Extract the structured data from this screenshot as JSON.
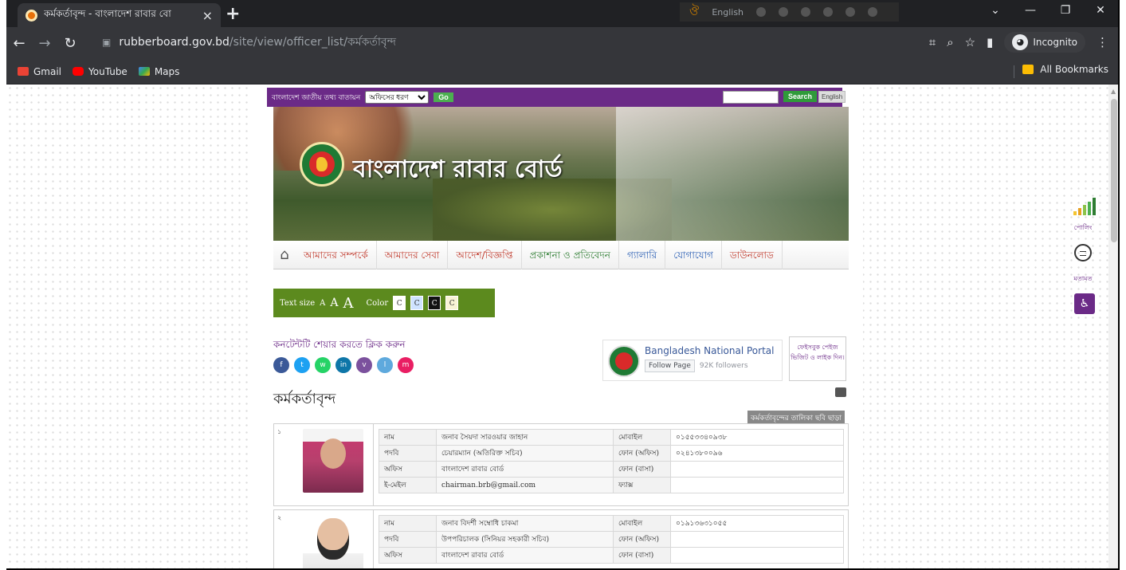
{
  "browser": {
    "tab_title": "কর্মকর্তাবৃন্দ - বাংলাদেশ রাবার বো",
    "new_tab_label": "+",
    "ime_language": "English",
    "url_host": "rubberboard.gov.bd",
    "url_path": "/site/view/officer_list/কর্মকর্তাবৃন্দ",
    "incognito_label": "Incognito",
    "bookmarks": [
      {
        "label": "Gmail",
        "color": "#ea4335"
      },
      {
        "label": "YouTube",
        "color": "#ff0000"
      },
      {
        "label": "Maps",
        "color": "#34a853"
      }
    ],
    "all_bookmarks_label": "All Bookmarks"
  },
  "site": {
    "portal_label": "বাংলাদেশ জাতীয় তথ্য বাতায়ন",
    "office_select": "অফিসের ধরণ",
    "go_label": "Go",
    "search_label": "Search",
    "language_label": "English",
    "board_name": "বাংলাদেশ রাবার বোর্ড",
    "menu": [
      "আমাদের সম্পর্কে",
      "আমাদের সেবা",
      "আদেশ/বিজ্ঞপ্তি",
      "প্রকাশনা ও প্রতিবেদন",
      "গ্যালারি",
      "যোগাযোগ",
      "ডাউনলোড"
    ],
    "text_size_label": "Text size",
    "size_small": "A",
    "size_medium": "A",
    "size_large": "A",
    "color_label": "Color",
    "color_swatch": "C",
    "share_label": "কনটেন্টটি শেয়ার করতে ক্লিক করুন",
    "share_icons": [
      "f",
      "t",
      "w",
      "in",
      "v",
      "l",
      "m"
    ],
    "share_colors": [
      "#3b5998",
      "#1da1f2",
      "#25d366",
      "#0e76a8",
      "#7b519d",
      "#5ea9dd",
      "#e91e63"
    ],
    "fb_page_name": "Bangladesh National Portal",
    "fb_follow_label": "Follow Page",
    "fb_followers": "92K followers",
    "like_box_text": "ফেইসবুক পেইজ ভিজিট ও লাইক দিন।",
    "page_title": "কর্মকর্তাবৃন্দ",
    "no_photo_label": "কর্মকর্তাবৃন্দের তালিকা ছবি ছাড়া"
  },
  "officers": [
    {
      "serial": "১",
      "name_label": "নাম",
      "name": "জনাব সৈয়দা সারওয়ার জাহান",
      "designation_label": "পদবি",
      "designation": "চেয়ারম্যান (অতিরিক্ত সচিব)",
      "office_label": "অফিস",
      "office": "বাংলাদেশ রাবার বোর্ড",
      "email_label": "ই-মেইল",
      "email": "chairman.brb@gmail.com",
      "mobile_label": "মোবাইল",
      "mobile": "০১৫৫৩৩৪০৯৩৮",
      "phone_office_label": "ফোন (অফিস)",
      "phone_office": "০২৪১৩৮০০৯৬",
      "phone_home_label": "ফোন (বাসা)",
      "phone_home": "",
      "fax_label": "ফ্যাক্স",
      "fax": ""
    },
    {
      "serial": "২",
      "name_label": "নাম",
      "name": "জনাব বিদর্শী সম্বোধি চাকমা",
      "designation_label": "পদবি",
      "designation": "উপপরিচালক (সিনিয়র সহকারী সচিব)",
      "office_label": "অফিস",
      "office": "বাংলাদেশ রাবার বোর্ড",
      "mobile_label": "মোবাইল",
      "mobile": "০১৯১৩৬৩১০৫৫",
      "phone_office_label": "ফোন (অফিস)",
      "phone_office": "",
      "phone_home_label": "ফোন (বাসা)",
      "phone_home": ""
    }
  ],
  "widgets": {
    "poll_label": "পোলিং",
    "feedback_label": "মতামত",
    "bar_colors": [
      "#f4c430",
      "#e8a020",
      "#8bc34a",
      "#4caf50",
      "#2e7d32"
    ]
  }
}
